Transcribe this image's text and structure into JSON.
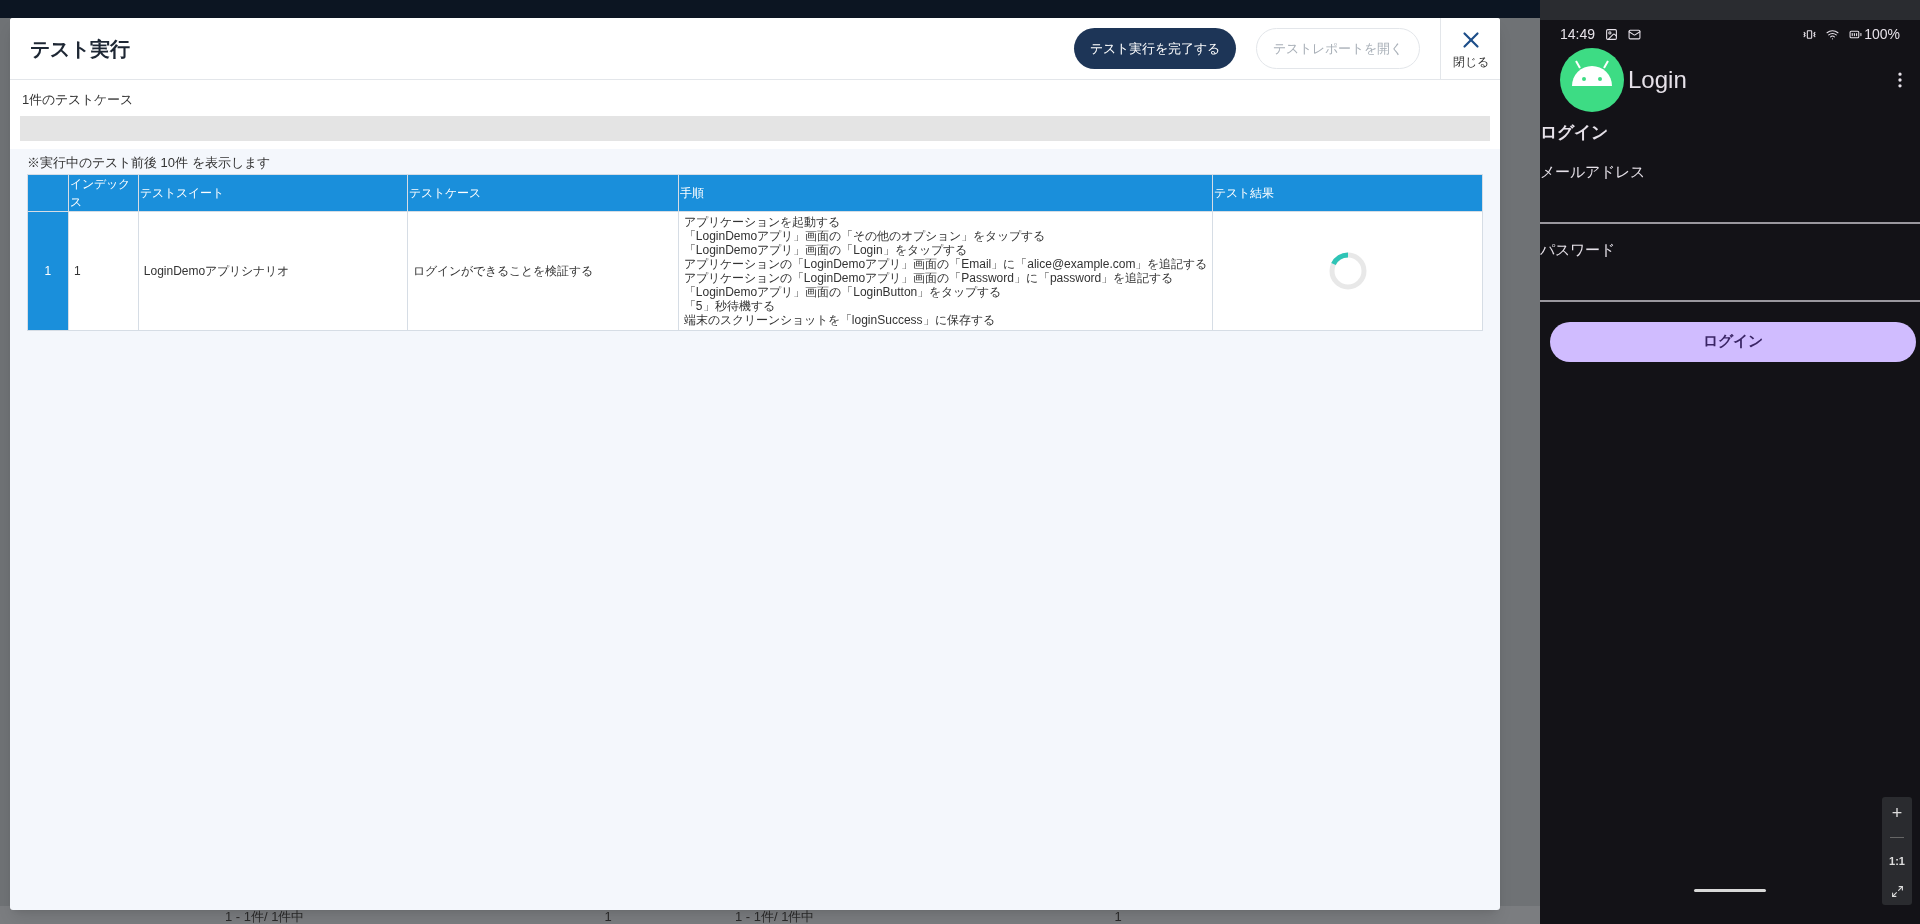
{
  "background": {
    "pagination": [
      {
        "range": "1 - 1件/ 1件中",
        "page": "1"
      },
      {
        "range": "1 - 1件/ 1件中",
        "page": "1"
      }
    ]
  },
  "modal": {
    "title": "テスト実行",
    "buttons": [
      {
        "label": "テスト実行を完了する",
        "disabled": false
      },
      {
        "label": "テストレポートを開く",
        "disabled": true
      }
    ],
    "close": {
      "label": "閉じる"
    },
    "case_count": "1件のテストケース",
    "note": "※実行中のテスト前後 10件 を表示します",
    "table": {
      "columns": [
        "インデックス",
        "テストスイート",
        "テストケース",
        "手順",
        "テスト結果"
      ],
      "rows": [
        {
          "number": "1",
          "index": "1",
          "suite": "LoginDemoアプリシナリオ",
          "case": "ログインができることを検証する",
          "running": true,
          "steps": [
            "アプリケーションを起動する",
            "「LoginDemoアプリ」画面の「その他のオプション」をタップする",
            "「LoginDemoアプリ」画面の「Login」をタップする",
            "アプリケーションの「LoginDemoアプリ」画面の「Email」に「alice@example.com」を追記する",
            "アプリケーションの「LoginDemoアプリ」画面の「Password」に「password」を追記する",
            "「LoginDemoアプリ」画面の「LoginButton」をタップする",
            "「5」秒待機する",
            "端末のスクリーンショットを「loginSuccess」に保存する"
          ]
        }
      ]
    }
  },
  "device": {
    "status_bar": {
      "time": "14:49",
      "battery": "100%"
    },
    "app_bar": {
      "title": "Login"
    },
    "screen_title": "ログイン",
    "fields": [
      {
        "label": "メールアドレス"
      },
      {
        "label": "パスワード"
      }
    ],
    "button": "ログイン",
    "zoom_controls": [
      "+",
      "1:1"
    ]
  }
}
